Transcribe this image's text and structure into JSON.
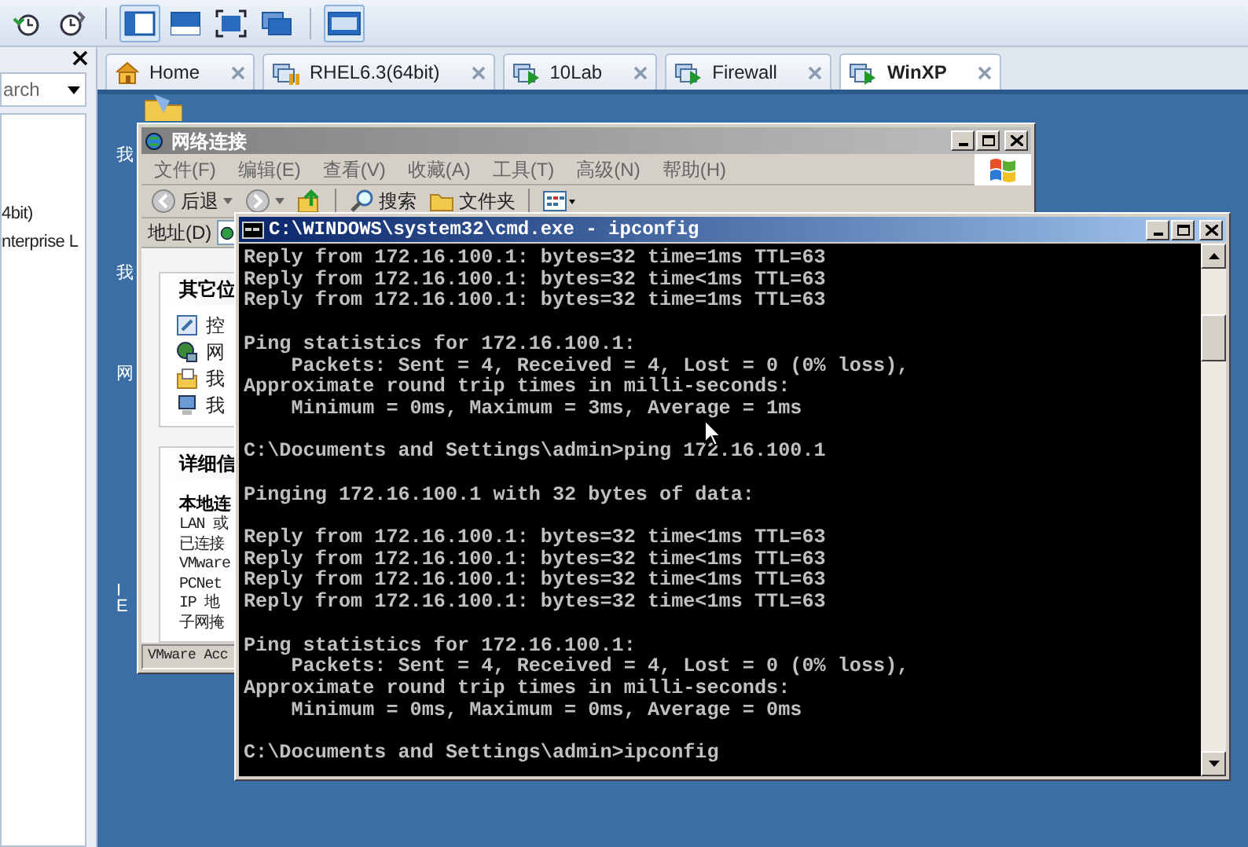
{
  "toolbar": {
    "buttons": [
      {
        "kind": "revert",
        "selected": false
      },
      {
        "kind": "manage",
        "selected": false
      },
      {
        "kind": "sidebar",
        "selected": true
      },
      {
        "kind": "thumbnails",
        "selected": false
      },
      {
        "kind": "fullscreen",
        "selected": false
      },
      {
        "kind": "unity",
        "selected": false
      },
      {
        "kind": "console",
        "selected": true
      }
    ]
  },
  "sidebar": {
    "search": {
      "value": "arch"
    },
    "items": [
      "4bit)",
      "nterprise L"
    ]
  },
  "tabs": [
    {
      "label": "Home",
      "kind": "home",
      "selected": false
    },
    {
      "label": "RHEL6.3(64bit)",
      "kind": "vm_suspended",
      "selected": false
    },
    {
      "label": "10Lab",
      "kind": "vm_running",
      "selected": false
    },
    {
      "label": "Firewall",
      "kind": "vm_running",
      "selected": false
    },
    {
      "label": "WinXP",
      "kind": "vm_running",
      "selected": true
    }
  ],
  "desktop": {
    "icon_labels": [
      "我",
      "我",
      "网",
      "I",
      "E"
    ]
  },
  "network_window": {
    "title": "网络连接",
    "menu": [
      "文件(F)",
      "编辑(E)",
      "查看(V)",
      "收藏(A)",
      "工具(T)",
      "高级(N)",
      "帮助(H)"
    ],
    "toolbar": [
      {
        "kind": "back",
        "label": "后退"
      },
      {
        "kind": "forward"
      },
      {
        "kind": "up"
      },
      {
        "kind": "search",
        "label": "搜索"
      },
      {
        "kind": "folders",
        "label": "文件夹"
      },
      {
        "kind": "views"
      }
    ],
    "address_label": "地址(D)",
    "tasks": {
      "title": "其它位",
      "items": [
        {
          "kind": "control",
          "label": "控"
        },
        {
          "kind": "network",
          "label": "网"
        },
        {
          "kind": "documents",
          "label": "我"
        },
        {
          "kind": "computer",
          "label": "我"
        }
      ]
    },
    "details": {
      "title": "详细信",
      "name": "本地连",
      "lines": [
        "LAN 或",
        "已连接",
        "VMware",
        "PCNet",
        "IP 地",
        "子网掩"
      ]
    },
    "status": "VMware Acc"
  },
  "cmd": {
    "title": "C:\\WINDOWS\\system32\\cmd.exe - ipconfig",
    "blocks": [
      [
        "Reply from 172.16.100.1: bytes=32 time=1ms TTL=63",
        "Reply from 172.16.100.1: bytes=32 time<1ms TTL=63",
        "Reply from 172.16.100.1: bytes=32 time=1ms TTL=63"
      ],
      [
        "Ping statistics for 172.16.100.1:",
        "    Packets: Sent = 4, Received = 4, Lost = 0 (0% loss),",
        "Approximate round trip times in milli-seconds:",
        "    Minimum = 0ms, Maximum = 3ms, Average = 1ms"
      ],
      [
        "C:\\Documents and Settings\\admin>ping 172.16.100.1"
      ],
      [
        "Pinging 172.16.100.1 with 32 bytes of data:"
      ],
      [
        "Reply from 172.16.100.1: bytes=32 time<1ms TTL=63",
        "Reply from 172.16.100.1: bytes=32 time<1ms TTL=63",
        "Reply from 172.16.100.1: bytes=32 time<1ms TTL=63",
        "Reply from 172.16.100.1: bytes=32 time<1ms TTL=63"
      ],
      [
        "Ping statistics for 172.16.100.1:",
        "    Packets: Sent = 4, Received = 4, Lost = 0 (0% loss),",
        "Approximate round trip times in milli-seconds:",
        "    Minimum = 0ms, Maximum = 0ms, Average = 0ms"
      ],
      [
        "C:\\Documents and Settings\\admin>ipconfig"
      ]
    ]
  }
}
